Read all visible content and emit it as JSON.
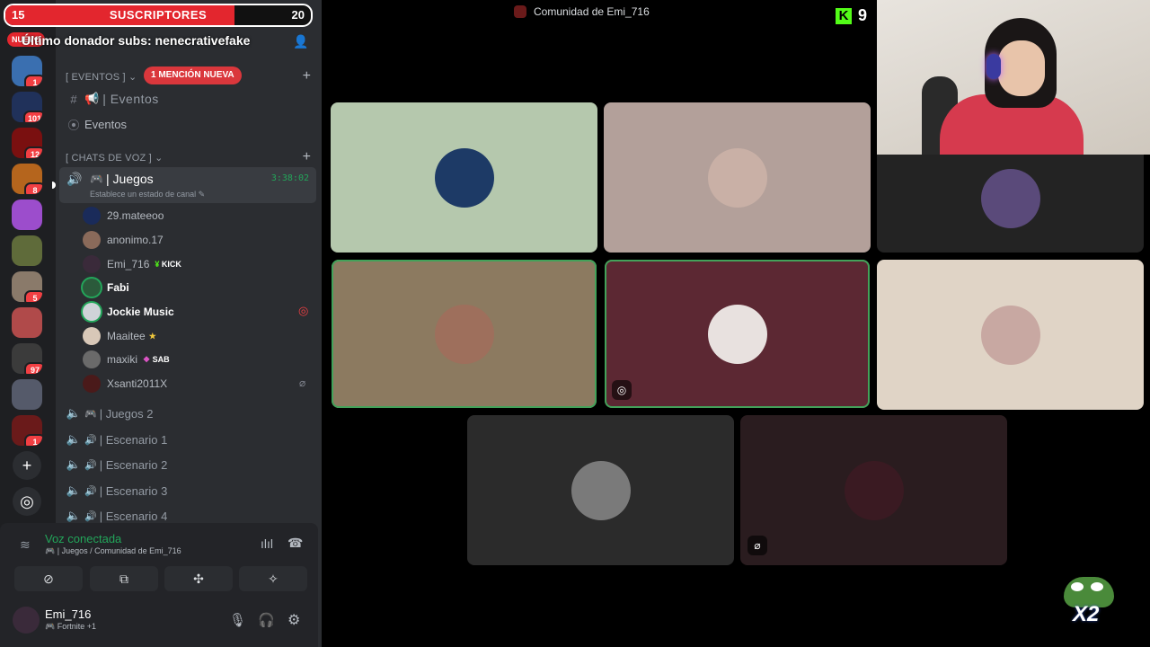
{
  "overlay": {
    "subs_current": "15",
    "subs_label": "SUSCRIPTORES",
    "subs_goal": "20",
    "subs_progress": 0.75,
    "last_donor": "Último donador subs: nenecrativefake",
    "new_label": "NUEVO",
    "kick_count": "9",
    "x2_label": "X2"
  },
  "window": {
    "title": "Comunidad de Emi_716"
  },
  "servers": [
    {
      "badge": "1",
      "color": "#3a6fb0"
    },
    {
      "badge": "101",
      "color": "#20315a"
    },
    {
      "badge": "12",
      "color": "#7a1010"
    },
    {
      "badge": "8",
      "color": "#b5651d"
    },
    {
      "badge": "",
      "color": "#9c4dcc"
    },
    {
      "badge": "",
      "color": "#5f6b3a"
    },
    {
      "badge": "5",
      "color": "#8a7a6a"
    },
    {
      "badge": "",
      "color": "#b04a4a"
    },
    {
      "badge": "97",
      "color": "#3b3b3b"
    },
    {
      "badge": "",
      "color": "#555a6a"
    },
    {
      "badge": "1",
      "color": "#6a1a1a"
    }
  ],
  "sidebar": {
    "eventos_category": "[ EVENTOS ]",
    "mention_badge": "1 MENCIÓN NUEVA",
    "events_channel": "| Eventos",
    "events_item": "Eventos",
    "voice_category": "[ CHATS DE VOZ ]",
    "active_channel": "| Juegos",
    "active_timer": "3:38:02",
    "status_prompt": "Establece un estado de canal",
    "members": [
      {
        "name": "29.mateeoo",
        "tag": "",
        "color": "#1a2b5a"
      },
      {
        "name": "anonimo.17",
        "tag": "",
        "color": "#8a6a5a"
      },
      {
        "name": "Emi_716",
        "tag": "KICK",
        "color": "#3a2a3a"
      },
      {
        "name": "Fabi",
        "tag": "",
        "color": "#2b5a3b"
      },
      {
        "name": "Jockie Music",
        "tag": "",
        "color": "#cfd3d8"
      },
      {
        "name": "Maaitee",
        "tag": "★",
        "color": "#d8c8b8"
      },
      {
        "name": "maxiki",
        "tag": "SAB",
        "color": "#6a6a6a"
      },
      {
        "name": "Xsanti2011X",
        "tag": "",
        "color": "#4a1a1a"
      }
    ],
    "voice_channels": [
      "| Juegos 2",
      "| Escenario 1",
      "| Escenario 2",
      "| Escenario 3",
      "| Escenario 4"
    ]
  },
  "voice_panel": {
    "status": "Voz conectada",
    "location": "| Juegos / Comunidad de Emi_716"
  },
  "user": {
    "name": "Emi_716",
    "activity": "Fortnite +1"
  },
  "tiles": [
    {
      "bg": "#b5c8ad",
      "avatar": "#1d3a66",
      "speaking": false
    },
    {
      "bg": "#b3a09a",
      "avatar": "#c9b0a6",
      "speaking": false
    },
    {
      "bg": "#232323",
      "avatar": "#5a4a7a",
      "speaking": false
    },
    {
      "bg": "#8c7a60",
      "avatar": "#9e6f5c",
      "speaking": true
    },
    {
      "bg": "#5c2833",
      "avatar": "#e8e1df",
      "speaking": true
    },
    {
      "bg": "#e0d4c6",
      "avatar": "#c8a8a2",
      "speaking": false
    },
    {
      "bg": "#2b2b2b",
      "avatar": "#7a7a7a",
      "speaking": false
    },
    {
      "bg": "#2a1c1f",
      "avatar": "#3a1a22",
      "speaking": false
    }
  ]
}
